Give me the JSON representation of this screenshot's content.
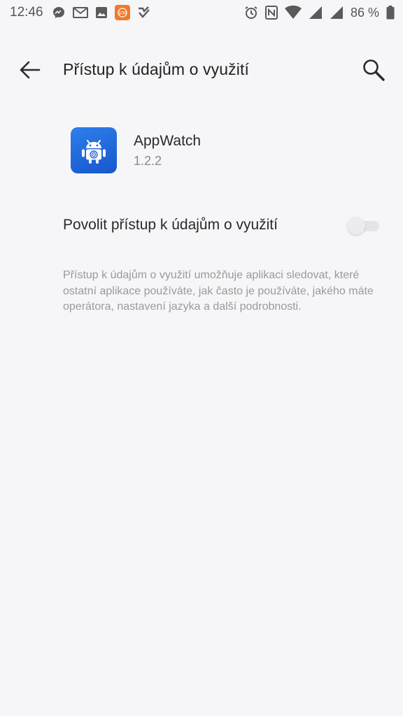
{
  "status_bar": {
    "time": "12:46",
    "battery_percent": "86 %",
    "left_icons": [
      "messenger-icon",
      "gmail-icon",
      "gallery-icon",
      "orange-app-icon",
      "check-app-icon"
    ],
    "right_icons": [
      "alarm-icon",
      "nfc-icon",
      "wifi-icon",
      "signal-icon",
      "signal-icon",
      "battery-icon"
    ]
  },
  "app_bar": {
    "title": "Přístup k údajům o využití",
    "back_icon": "arrow-back-icon",
    "search_icon": "search-icon"
  },
  "app": {
    "name": "AppWatch",
    "version": "1.2.2",
    "icon": "android-robot-icon",
    "icon_color": "#1f6ae0"
  },
  "setting": {
    "label": "Povolit přístup k údajům o využití",
    "enabled": false
  },
  "description": "Přístup k údajům o využití umožňuje aplikaci sledovat, které ostatní aplikace používáte, jak často je používáte, jakého máte operátora, nastavení jazyka a další podrobnosti."
}
